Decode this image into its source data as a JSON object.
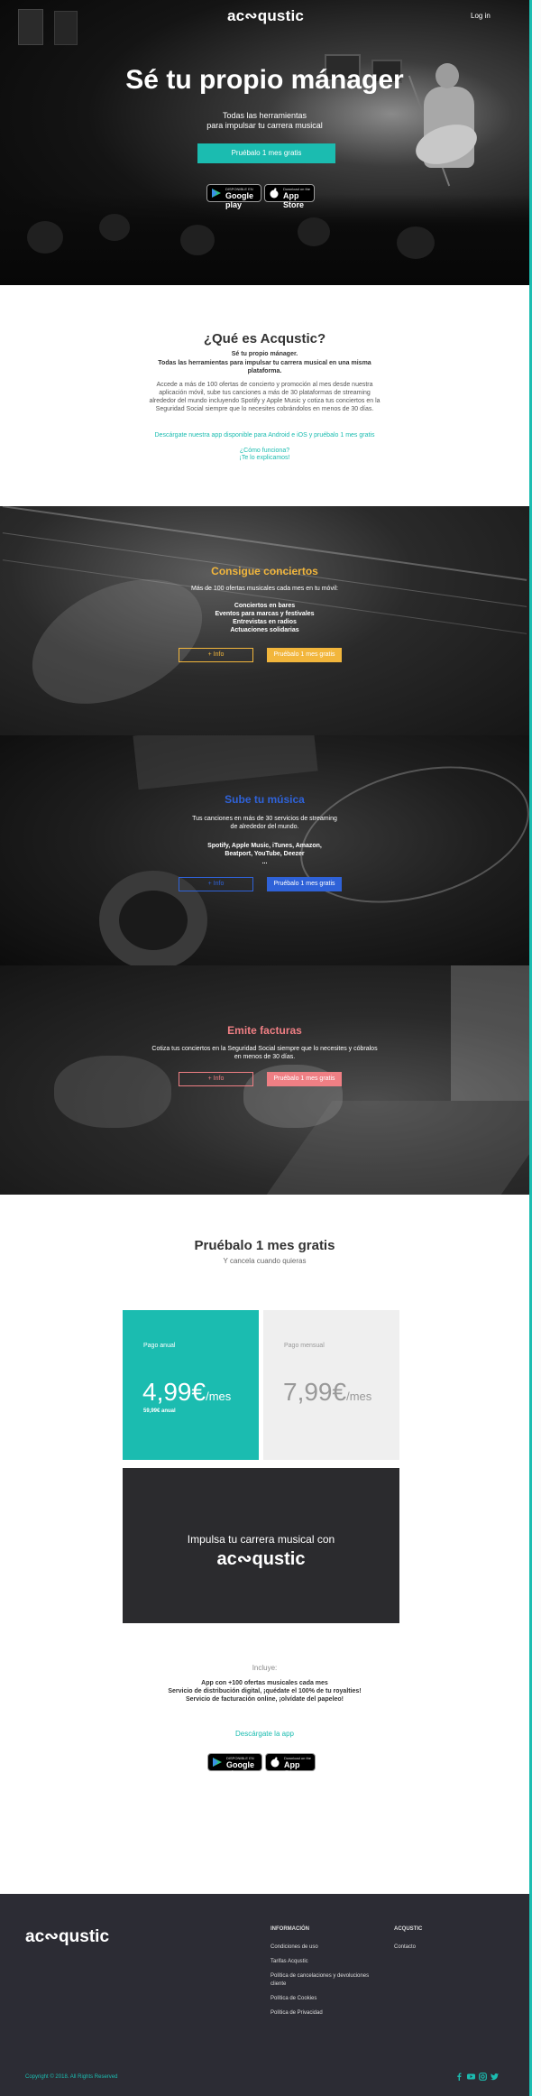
{
  "nav": {
    "logo": "ac∾qustic",
    "login": "Log in"
  },
  "hero": {
    "title": "Sé tu propio mánager",
    "subtitle_line1": "Todas las herramientas",
    "subtitle_line2": "para impulsar tu carrera musical",
    "cta": "Pruébalo 1 mes gratis",
    "google_small": "DISPONIBLE EN",
    "google_main": "Google play",
    "apple_small": "Download on the",
    "apple_main": "App Store"
  },
  "about": {
    "title": "¿Qué es Acqustic?",
    "bold1": "Sé tu propio mánager.",
    "bold2": "Todas las herramientas para impulsar tu carrera musical en una misma plataforma.",
    "paragraph": "Accede a más de 100 ofertas de concierto y promoción al mes desde nuestra aplicación móvil, sube tus canciones a más de 30 plataformas de streaming alrededor del mundo incluyendo Spotify y Apple Music y cotiza tus conciertos en la Seguridad Social siempre que lo necesites cobrándolos en menos de 30 días.",
    "link_download": "Descárgate nuestra app disponible para Android e iOS y pruébalo 1 mes gratis",
    "link_how": "¿Cómo funciona?",
    "link_explain": "¡Te lo explicamos!"
  },
  "features": [
    {
      "title": "Consigue conciertos",
      "text": "Más de 100 ofertas musicales cada mes en tu móvil:",
      "items": [
        "Conciertos en bares",
        "Eventos para marcas y festivales",
        "Entrevistas en radios",
        "Actuaciones solidarias"
      ],
      "more": "+ Info",
      "cta": "Pruébalo 1 mes gratis",
      "color": "#f2b63c"
    },
    {
      "title": "Sube tu música",
      "text": "Tus canciones en más de 30 servicios de streaming de alrededor del mundo.",
      "items": [
        "Spotify, Apple Music, iTunes, Amazon,",
        "Beatport, YouTube, Deezer",
        "..."
      ],
      "more": "+ Info",
      "cta": "Pruébalo 1 mes gratis",
      "color": "#2f62d8"
    },
    {
      "title": "Emite facturas",
      "text": "Cotiza tus conciertos en la Seguridad Social siempre que lo necesites y cóbralos en menos de 30 días.",
      "items": [],
      "more": "+ Info",
      "cta": "Pruébalo 1 mes gratis",
      "color": "#ef7f84"
    }
  ],
  "pricing": {
    "title": "Pruébalo 1 mes gratis",
    "subtitle": "Y cancela cuando quieras",
    "annual": {
      "label": "Pago anual",
      "price": "4,99€",
      "unit": "/mes",
      "note": "59,99€ anual"
    },
    "monthly": {
      "label": "Pago mensual",
      "price": "7,99€",
      "unit": "/mes"
    },
    "banner_text": "Impulsa tu carrera musical con",
    "banner_logo": "ac∾qustic"
  },
  "includes": {
    "heading": "Incluye:",
    "lines": [
      "App con +100 ofertas musicales cada mes",
      "Servicio de distribución digital, ¡quédate el 100% de tu royalties!",
      "Servicio de facturación online, ¡olvídate del papeleo!"
    ],
    "download": "Descárgate la app"
  },
  "footer": {
    "logo": "ac∾qustic",
    "col1_title": "INFORMACIÓN",
    "col1_links": [
      "Condiciones de uso",
      "Tarifas Acqustic",
      "Política de cancelaciones y devoluciones cliente",
      "Política de Cookies",
      "Política de Privacidad"
    ],
    "col2_title": "ACQUSTIC",
    "col2_links": [
      "Contacto"
    ],
    "copyright": "Copyright © 2018. All Rights Reserved",
    "social": [
      "facebook-icon",
      "youtube-icon",
      "instagram-icon",
      "twitter-icon"
    ]
  },
  "colors": {
    "accent": "#1bbcb0",
    "footer_bg": "#2c2c34",
    "banner_bg": "#2b2b2e"
  }
}
